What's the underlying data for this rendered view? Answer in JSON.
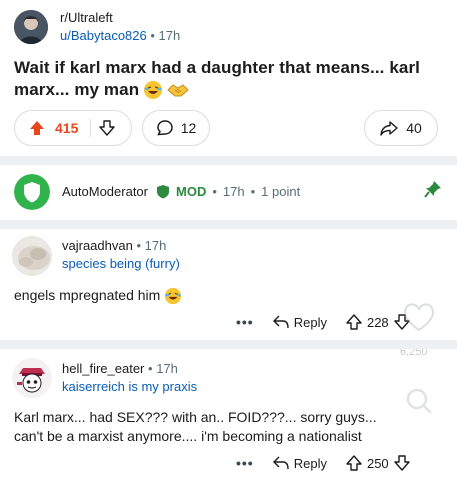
{
  "post": {
    "subreddit": "r/Ultraleft",
    "author": "u/Babytaco826",
    "age": "17h",
    "title_line1": "Wait if karl marx had a daughter that means... karl",
    "title_line2": "marx... my man",
    "upvotes": "415",
    "comments": "12",
    "shares": "40"
  },
  "automod": {
    "author": "AutoModerator",
    "badge": "MOD",
    "age": "17h",
    "points": "1 point"
  },
  "comments": [
    {
      "author": "vajraadhvan",
      "age": "17h",
      "flair": "species being (furry)",
      "text": "engels mpregnated him",
      "reply_label": "Reply",
      "votes": "228"
    },
    {
      "author": "hell_fire_eater",
      "age": "17h",
      "flair": "kaiserreich is my praxis",
      "text_line1": "Karl marx... had SEX??? with an.. FOID???... sorry guys...",
      "text_line2": "can't be a marxist anymore.... i'm becoming a nationalist",
      "reply_label": "Reply",
      "votes": "250"
    }
  ],
  "watermark": "6,250",
  "colors": {
    "upvote": "#e8461d",
    "link": "#0a5cb7",
    "mod_green": "#2b8a3e",
    "separator": "#eef1f3"
  }
}
